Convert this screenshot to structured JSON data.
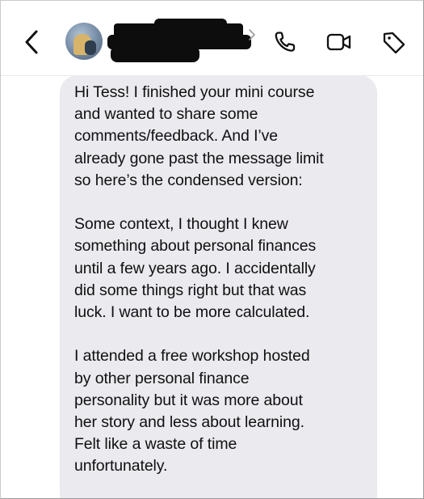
{
  "header": {
    "back_icon": "chevron-left-icon",
    "avatar_icon": "profile-photo",
    "name_redacted": true,
    "name_chevron_icon": "chevron-right-icon",
    "actions": [
      {
        "name": "call",
        "icon": "phone-icon"
      },
      {
        "name": "video",
        "icon": "video-camera-icon"
      },
      {
        "name": "tag",
        "icon": "tag-icon"
      }
    ]
  },
  "message": {
    "paragraphs": [
      {
        "lines": [
          "Hi Tess! I finished your mini course",
          "and wanted to share some",
          "comments/feedback. And I’ve",
          "already gone past the message limit",
          "so here’s the condensed version:"
        ]
      },
      {
        "lines": [
          "Some context, I thought I knew",
          "something about personal finances",
          "until a few years ago. I accidentally",
          "did some things right but that was",
          "luck. I want to be more calculated."
        ]
      },
      {
        "lines": [
          "I attended a free workshop hosted",
          "by other personal finance",
          "personality but it was more about",
          "her story and less about learning.",
          "Felt like a waste of time",
          "unfortunately."
        ]
      }
    ]
  },
  "colors": {
    "bubble": "#eaeaef",
    "text": "#101010",
    "icons": "#111111",
    "redaction": "#0d0d0d"
  }
}
